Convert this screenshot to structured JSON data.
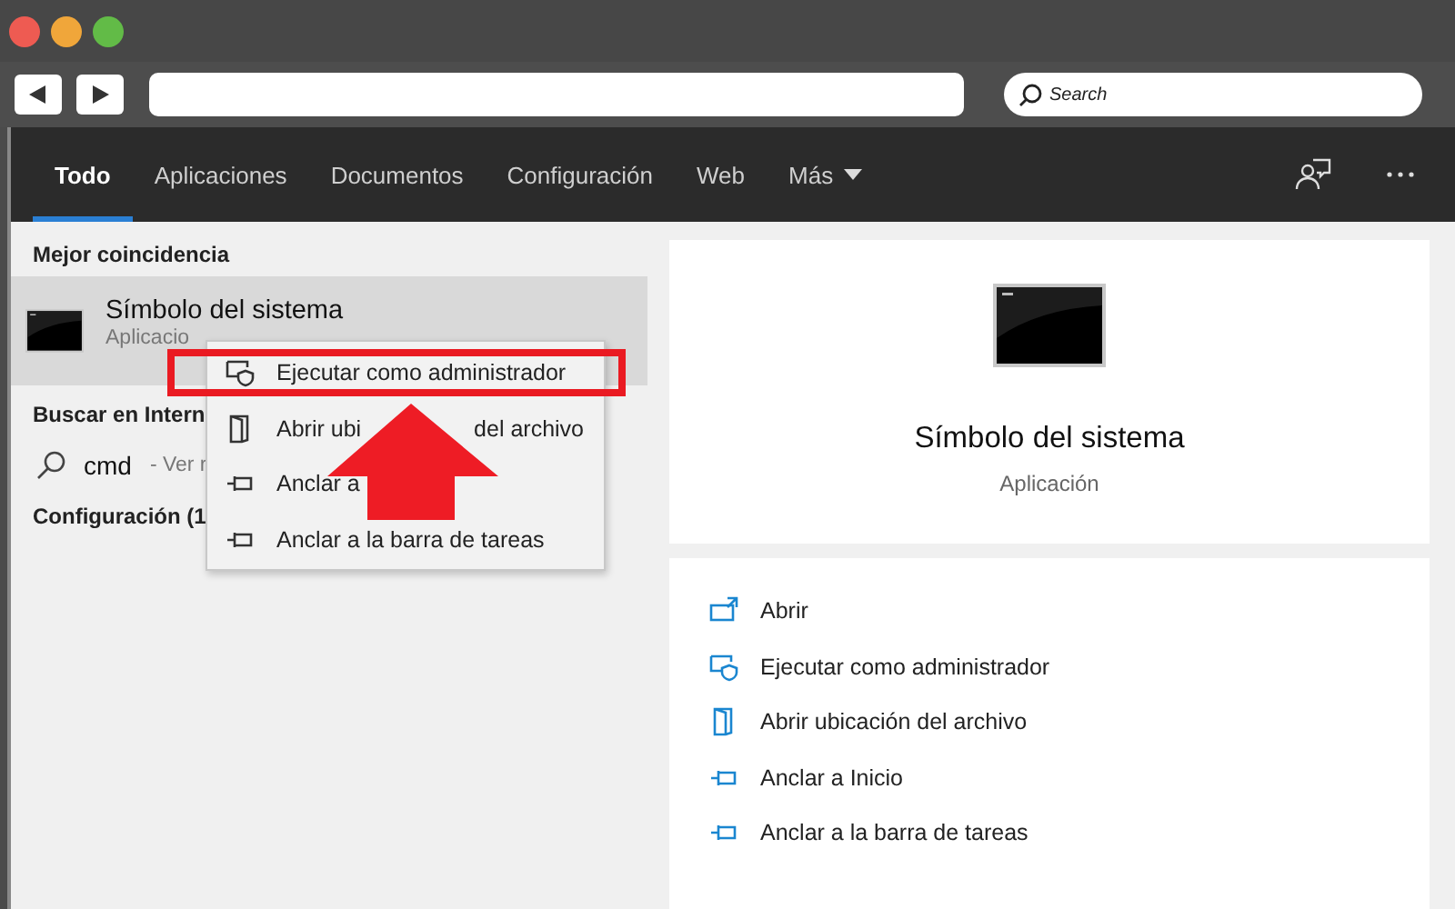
{
  "browser": {
    "search": {
      "placeholder": "Search"
    }
  },
  "tabs": [
    {
      "label": "Todo",
      "selected": true
    },
    {
      "label": "Aplicaciones",
      "selected": false
    },
    {
      "label": "Documentos",
      "selected": false
    },
    {
      "label": "Configuración",
      "selected": false
    },
    {
      "label": "Web",
      "selected": false
    },
    {
      "label": "Más",
      "selected": false,
      "dropdown": true
    }
  ],
  "results": {
    "best_match": {
      "heading": "Mejor coincidencia",
      "title": "Símbolo del sistema",
      "subtitle": "Aplicacio",
      "selected": true
    },
    "web": {
      "heading": "Buscar en Intern",
      "query": "cmd",
      "hint": "- Ver r"
    },
    "settings": {
      "heading": "Configuración (1"
    }
  },
  "context_menu": [
    {
      "kind": "admin",
      "label": "Ejecutar como administrador",
      "highlighted": true
    },
    {
      "kind": "folder",
      "label": "Abrir ubi",
      "label_after": "del archivo",
      "highlighted": false
    },
    {
      "kind": "pin",
      "label": "Anclar a",
      "highlighted": false
    },
    {
      "kind": "pin",
      "label": "Anclar a la barra de tareas",
      "highlighted": false
    }
  ],
  "detail": {
    "title": "Símbolo del sistema",
    "subtitle": "Aplicación",
    "actions": [
      {
        "kind": "open",
        "label": "Abrir"
      },
      {
        "kind": "admin",
        "label": "Ejecutar como administrador"
      },
      {
        "kind": "folder",
        "label": "Abrir ubicación del archivo"
      },
      {
        "kind": "pin",
        "label": "Anclar a Inicio"
      },
      {
        "kind": "pin",
        "label": "Anclar a la barra de tareas"
      }
    ]
  }
}
